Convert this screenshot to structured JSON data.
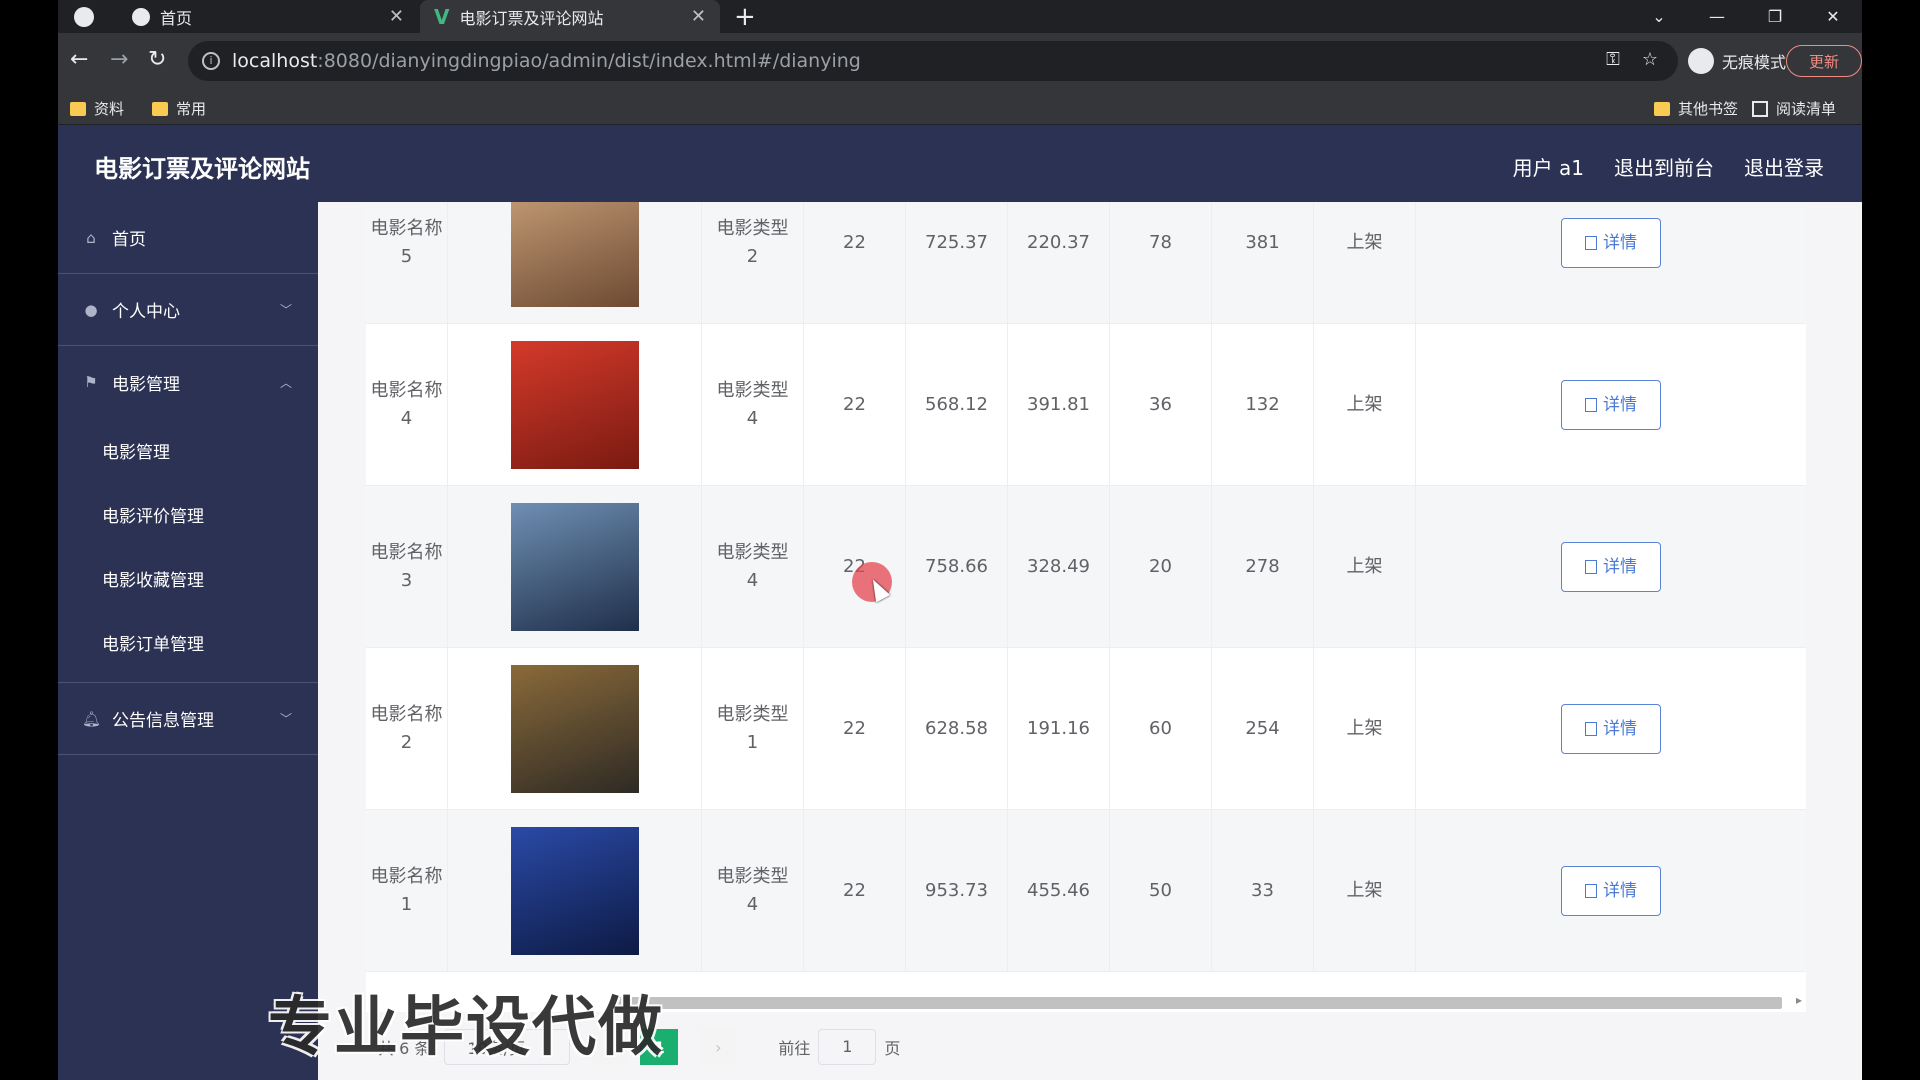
{
  "browser": {
    "tabs": [
      {
        "title": "首页",
        "active": false
      },
      {
        "title": "电影订票及评论网站",
        "active": true
      }
    ],
    "url_host": "localhost",
    "url_path": ":8080/dianyingdingpiao/admin/dist/index.html#/dianying",
    "incognito_label": "无痕模式",
    "update_label": "更新",
    "bookmarks_left": [
      "资料",
      "常用"
    ],
    "bookmarks_right": [
      "其他书签",
      "阅读清单"
    ]
  },
  "header": {
    "title": "电影订票及评论网站",
    "user": "用户 a1",
    "back_front": "退出到前台",
    "logout": "退出登录"
  },
  "sidebar": {
    "items": [
      {
        "label": "首页",
        "icon": "home-icon"
      },
      {
        "label": "个人中心",
        "icon": "user-icon"
      },
      {
        "label": "电影管理",
        "icon": "flag-icon"
      },
      {
        "label": "公告信息管理",
        "icon": "bell-icon"
      }
    ],
    "sub_items": [
      "电影管理",
      "电影评价管理",
      "电影收藏管理",
      "电影订单管理"
    ]
  },
  "table": {
    "detail_label": "详情",
    "rows": [
      {
        "name": "电影名称\n5",
        "type": "电影类型\n2",
        "c1": "22",
        "c2": "725.37",
        "c3": "220.37",
        "c4": "78",
        "c5": "381",
        "status": "上架",
        "poster_colors": [
          "#c9a07a",
          "#6d4a32"
        ]
      },
      {
        "name": "电影名称\n4",
        "type": "电影类型\n4",
        "c1": "22",
        "c2": "568.12",
        "c3": "391.81",
        "c4": "36",
        "c5": "132",
        "status": "上架",
        "poster_colors": [
          "#d43a2a",
          "#7a1a12"
        ]
      },
      {
        "name": "电影名称\n3",
        "type": "电影类型\n4",
        "c1": "22",
        "c2": "758.66",
        "c3": "328.49",
        "c4": "20",
        "c5": "278",
        "status": "上架",
        "poster_colors": [
          "#6f8fb3",
          "#1f2f4a"
        ]
      },
      {
        "name": "电影名称\n2",
        "type": "电影类型\n1",
        "c1": "22",
        "c2": "628.58",
        "c3": "191.16",
        "c4": "60",
        "c5": "254",
        "status": "上架",
        "poster_colors": [
          "#8a6a3a",
          "#2e2a24"
        ]
      },
      {
        "name": "电影名称\n1",
        "type": "电影类型\n4",
        "c1": "22",
        "c2": "953.73",
        "c3": "455.46",
        "c4": "50",
        "c5": "33",
        "status": "上架",
        "poster_colors": [
          "#2a4aa6",
          "#0d1a44"
        ]
      }
    ]
  },
  "pager": {
    "total": "共 6 条",
    "size": "10条/页",
    "current": "1",
    "goto_prefix": "前往",
    "goto_value": "1",
    "goto_suffix": "页"
  },
  "watermark": "专业毕设代做"
}
